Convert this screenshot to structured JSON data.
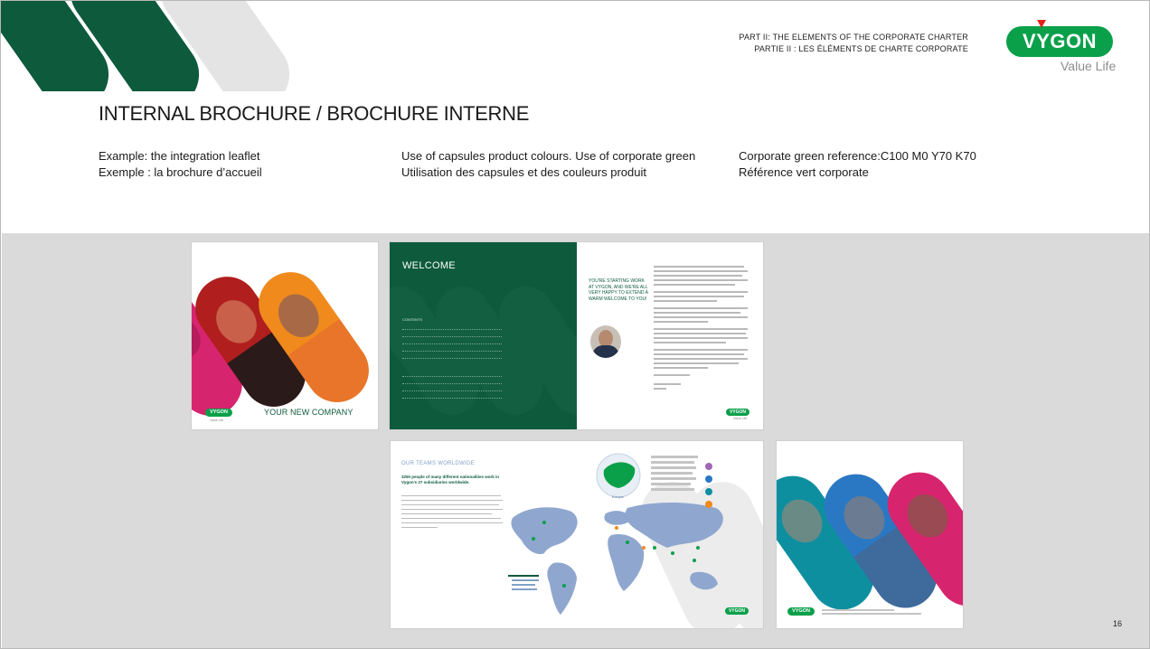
{
  "header": {
    "part_en": "PART II: THE ELEMENTS OF THE CORPORATE CHARTER",
    "part_fr": "PARTIE II :  LES ÉLÉMENTS DE CHARTE CORPORATE"
  },
  "logo": {
    "brand": "VYGON",
    "tagline": "Value Life"
  },
  "title": "INTERNAL BROCHURE / BROCHURE INTERNE",
  "descriptions": {
    "col1_en": "Example: the integration leaflet",
    "col1_fr": "Exemple : la brochure d’accueil",
    "col2_en": "Use of capsules product colours. Use of corporate green",
    "col2_fr": "Utilisation des capsules et des couleurs produit",
    "col3_en": "Corporate green reference:C100 M0 Y70 K70",
    "col3_fr": "Référence vert corporate"
  },
  "brochure": {
    "cover_title": "YOUR NEW COMPANY",
    "welcome_title": "WELCOME",
    "contents_label": "CONTENTS",
    "welcome_heading": "YOU'RE STARTING WORK AT VYGON, AND WE'RE ALL VERY HAPPY TO EXTEND A WARM WELCOME TO YOU!",
    "teams_title": "OUR TEAMS WORLDWIDE",
    "teams_subtitle": "3250 people of many different nationalities work in Vygon's 27 subsidiaries worldwide.",
    "map_region": "Europe",
    "small_logo": "VYGON",
    "small_tagline": "Value Life"
  },
  "colors": {
    "corporate_green": "#0d5a3c",
    "vygon_green": "#0aa04a",
    "accent_red": "#e2231a",
    "capsule_gray": "#e4e4e4",
    "map_blue": "#8fa7cf",
    "magenta": "#d6246e",
    "orange": "#f08a1c",
    "teal": "#0e8fa0",
    "blue": "#2a78c4"
  },
  "page_number": "16"
}
